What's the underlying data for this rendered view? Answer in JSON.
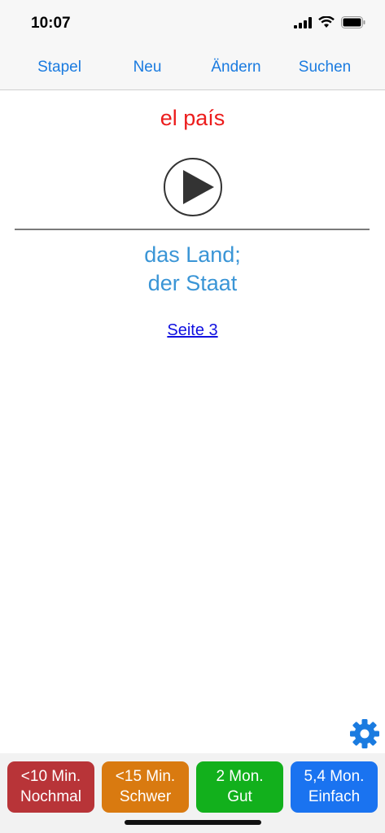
{
  "status": {
    "time": "10:07"
  },
  "toolbar": {
    "stapel": "Stapel",
    "neu": "Neu",
    "aendern": "Ändern",
    "suchen": "Suchen"
  },
  "card": {
    "front": "el país",
    "back_line1": "das Land;",
    "back_line2": "der Staat",
    "page_link": "Seite 3"
  },
  "answers": [
    {
      "time": "<10 Min.",
      "label": "Nochmal",
      "color": "#b83438"
    },
    {
      "time": "<15 Min.",
      "label": "Schwer",
      "color": "#d97a10"
    },
    {
      "time": "2 Mon.",
      "label": "Gut",
      "color": "#12b01c"
    },
    {
      "time": "5,4 Mon.",
      "label": "Einfach",
      "color": "#1a73f0"
    }
  ],
  "colors": {
    "front_text": "#ec1c1c",
    "back_text": "#3a95d6",
    "toolbar_text": "#1a7be0",
    "gear": "#1a7be0"
  },
  "icons": {
    "play": "play-icon",
    "settings": "gear-icon",
    "signal": "signal-icon",
    "wifi": "wifi-icon",
    "battery": "battery-icon"
  }
}
